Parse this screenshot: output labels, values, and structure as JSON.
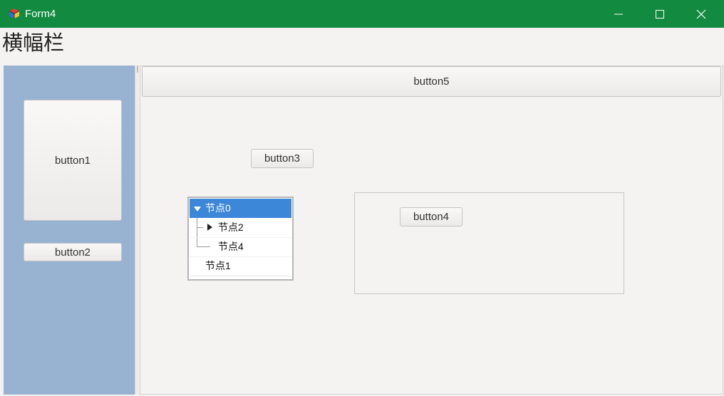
{
  "window": {
    "title": "Form4",
    "icon": "app-cube-icon",
    "controls": [
      "minimize-icon",
      "maximize-icon",
      "close-icon"
    ],
    "titlebar_color": "#128a3f"
  },
  "banner": {
    "text": "横幅栏"
  },
  "left_panel": {
    "background": "#98b2d1",
    "buttons": {
      "button1": "button1",
      "button2": "button2"
    }
  },
  "right_panel": {
    "buttons": {
      "button5": "button5",
      "button3": "button3",
      "button4": "button4"
    },
    "tree": {
      "nodes": [
        {
          "label": "节点0",
          "expanded": true,
          "selected": true
        },
        {
          "label": "节点2",
          "expanded": false
        },
        {
          "label": "节点4"
        },
        {
          "label": "节点1"
        }
      ],
      "selection_color": "#3d87d8"
    }
  }
}
